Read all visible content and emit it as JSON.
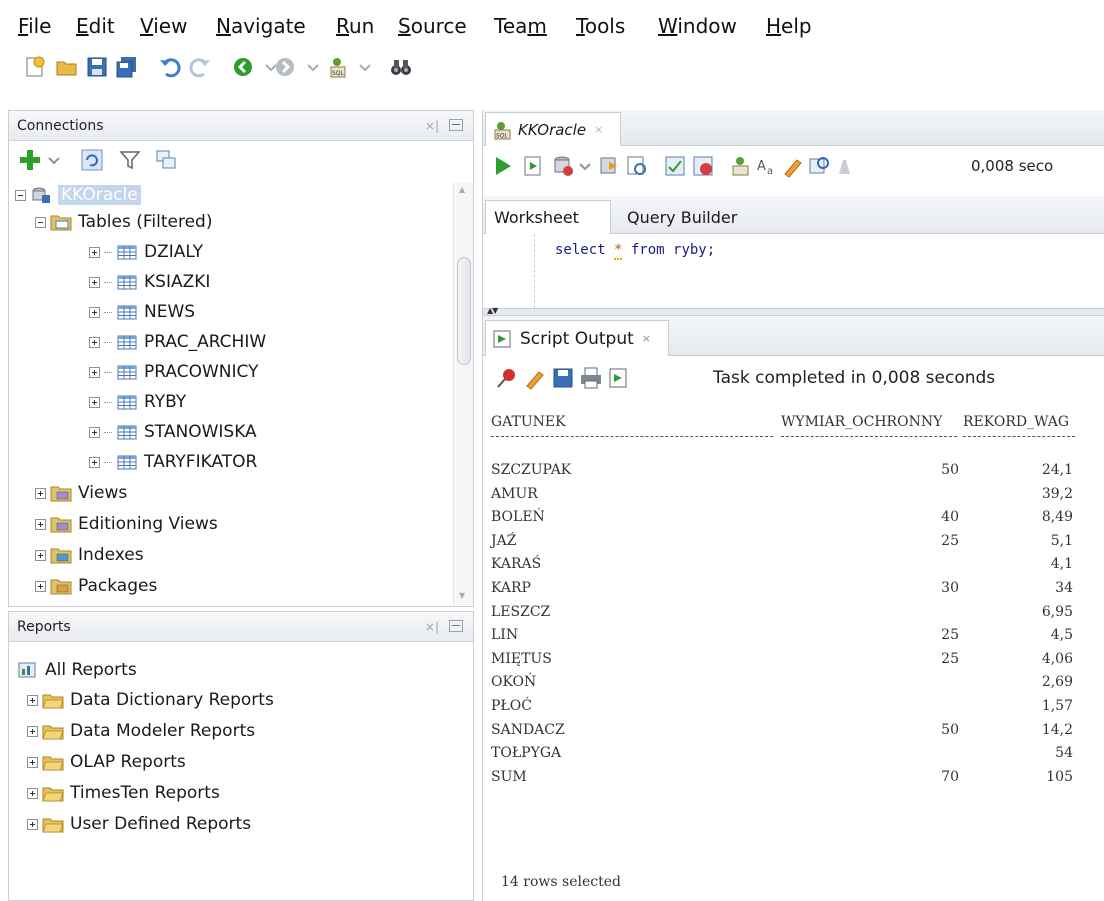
{
  "menu": [
    {
      "label": "File",
      "mnemonic": "F",
      "rest": "ile"
    },
    {
      "label": "Edit",
      "mnemonic": "E",
      "rest": "dit"
    },
    {
      "label": "View",
      "mnemonic": "V",
      "rest": "iew"
    },
    {
      "label": "Navigate",
      "mnemonic": "N",
      "rest": "avigate"
    },
    {
      "label": "Run",
      "mnemonic": "R",
      "rest": "un"
    },
    {
      "label": "Source",
      "mnemonic": "S",
      "rest": "ource"
    },
    {
      "label": "Team",
      "pre": "Tea",
      "mnemonic": "m",
      "rest": ""
    },
    {
      "label": "Tools",
      "mnemonic": "T",
      "rest": "ools"
    },
    {
      "label": "Window",
      "mnemonic": "W",
      "rest": "indow"
    },
    {
      "label": "Help",
      "mnemonic": "H",
      "rest": "elp"
    }
  ],
  "toolbar_icons": [
    "new-icon",
    "open-icon",
    "save-icon",
    "save-all-icon",
    "undo-icon",
    "redo-icon",
    "back-icon",
    "forward-icon",
    "sql-worksheet-icon",
    "find-binoculars-icon"
  ],
  "connections": {
    "title": "Connections",
    "connection_name": "KKOracle",
    "tables_label": "Tables (Filtered)",
    "tables": [
      "DZIALY",
      "KSIAZKI",
      "NEWS",
      "PRAC_ARCHIW",
      "PRACOWNICY",
      "RYBY",
      "STANOWISKA",
      "TARYFIKATOR"
    ],
    "other_nodes": [
      "Views",
      "Editioning Views",
      "Indexes",
      "Packages"
    ]
  },
  "reports": {
    "title": "Reports",
    "root": "All Reports",
    "items": [
      "Data Dictionary Reports",
      "Data Modeler Reports",
      "OLAP Reports",
      "TimesTen Reports",
      "User Defined Reports"
    ]
  },
  "editor": {
    "tab_label": "KKOracle",
    "close_glyph": "×",
    "elapsed": "0,008 seco",
    "worksheet_tab": "Worksheet",
    "query_builder_tab": "Query Builder",
    "sql_before": "select ",
    "sql_star": "*",
    "sql_after": " from ryby;"
  },
  "output": {
    "tab_label": "Script Output",
    "close_glyph": "×",
    "status": "Task completed in 0,008 seconds",
    "columns": [
      "GATUNEK",
      "WYMIAR_OCHRONNY",
      "REKORD_WAG"
    ],
    "rows": [
      {
        "gatunek": "SZCZUPAK",
        "wymiar": "50",
        "rekord": "24,1"
      },
      {
        "gatunek": "AMUR",
        "wymiar": "",
        "rekord": "39,2"
      },
      {
        "gatunek": "BOLEŃ",
        "wymiar": "40",
        "rekord": "8,49"
      },
      {
        "gatunek": "JAŹ",
        "wymiar": "25",
        "rekord": "5,1"
      },
      {
        "gatunek": "KARAŚ",
        "wymiar": "",
        "rekord": "4,1"
      },
      {
        "gatunek": "KARP",
        "wymiar": "30",
        "rekord": "34"
      },
      {
        "gatunek": "LESZCZ",
        "wymiar": "",
        "rekord": "6,95"
      },
      {
        "gatunek": "LIN",
        "wymiar": "25",
        "rekord": "4,5"
      },
      {
        "gatunek": "MIĘTUS",
        "wymiar": "25",
        "rekord": "4,06"
      },
      {
        "gatunek": "OKOŃ",
        "wymiar": "",
        "rekord": "2,69"
      },
      {
        "gatunek": "PŁOĆ",
        "wymiar": "",
        "rekord": "1,57"
      },
      {
        "gatunek": "SANDACZ",
        "wymiar": "50",
        "rekord": "14,2"
      },
      {
        "gatunek": "TOŁPYGA",
        "wymiar": "",
        "rekord": "54"
      },
      {
        "gatunek": "SUM",
        "wymiar": "70",
        "rekord": "105"
      }
    ],
    "footer": "14 rows selected"
  },
  "colors": {
    "accent_green": "#2e9d2e",
    "selection_blue": "#c4d6ec",
    "panel_border": "#c9ced4"
  }
}
